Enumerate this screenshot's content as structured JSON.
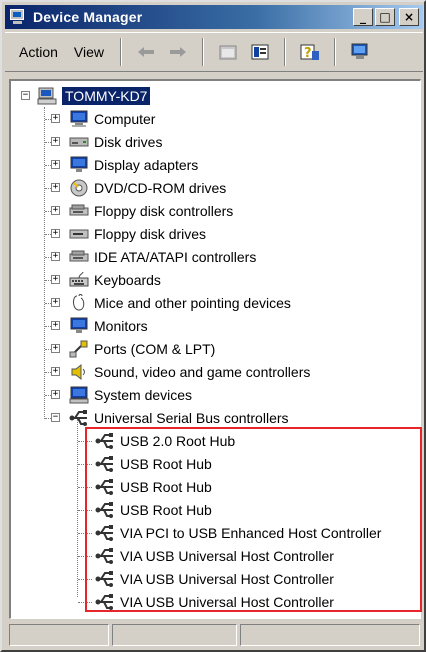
{
  "window": {
    "title": "Device Manager",
    "buttons": {
      "minimize": "_",
      "maximize": "□",
      "close": "×"
    }
  },
  "menu": {
    "action": "Action",
    "view": "View"
  },
  "toolbar": {
    "icons": [
      "back-arrow-icon",
      "forward-arrow-icon",
      "properties-icon",
      "tree-view-icon",
      "help-icon",
      "scan-hardware-icon"
    ]
  },
  "tree": {
    "root": "TOMMY-KD7",
    "categories": [
      {
        "label": "Computer",
        "icon": "computer-icon"
      },
      {
        "label": "Disk drives",
        "icon": "disk-drive-icon"
      },
      {
        "label": "Display adapters",
        "icon": "display-adapter-icon"
      },
      {
        "label": "DVD/CD-ROM drives",
        "icon": "cdrom-icon"
      },
      {
        "label": "Floppy disk controllers",
        "icon": "controller-icon"
      },
      {
        "label": "Floppy disk drives",
        "icon": "floppy-drive-icon"
      },
      {
        "label": "IDE ATA/ATAPI controllers",
        "icon": "controller-icon"
      },
      {
        "label": "Keyboards",
        "icon": "keyboard-icon"
      },
      {
        "label": "Mice and other pointing devices",
        "icon": "mouse-icon"
      },
      {
        "label": "Monitors",
        "icon": "monitor-icon"
      },
      {
        "label": "Ports (COM & LPT)",
        "icon": "port-icon"
      },
      {
        "label": "Sound, video and game controllers",
        "icon": "sound-icon"
      },
      {
        "label": "System devices",
        "icon": "system-icon"
      },
      {
        "label": "Universal Serial Bus controllers",
        "icon": "usb-icon"
      }
    ],
    "usb_children": [
      "USB 2.0 Root Hub",
      "USB Root Hub",
      "USB Root Hub",
      "USB Root Hub",
      "VIA PCI to USB Enhanced Host Controller",
      "VIA USB Universal Host Controller",
      "VIA USB Universal Host Controller",
      "VIA USB Universal Host Controller"
    ]
  },
  "colors": {
    "titlebar": "#0a246a",
    "face": "#d4d0c8",
    "highlight_box": "#e8262a",
    "selection": "#0a246a"
  }
}
